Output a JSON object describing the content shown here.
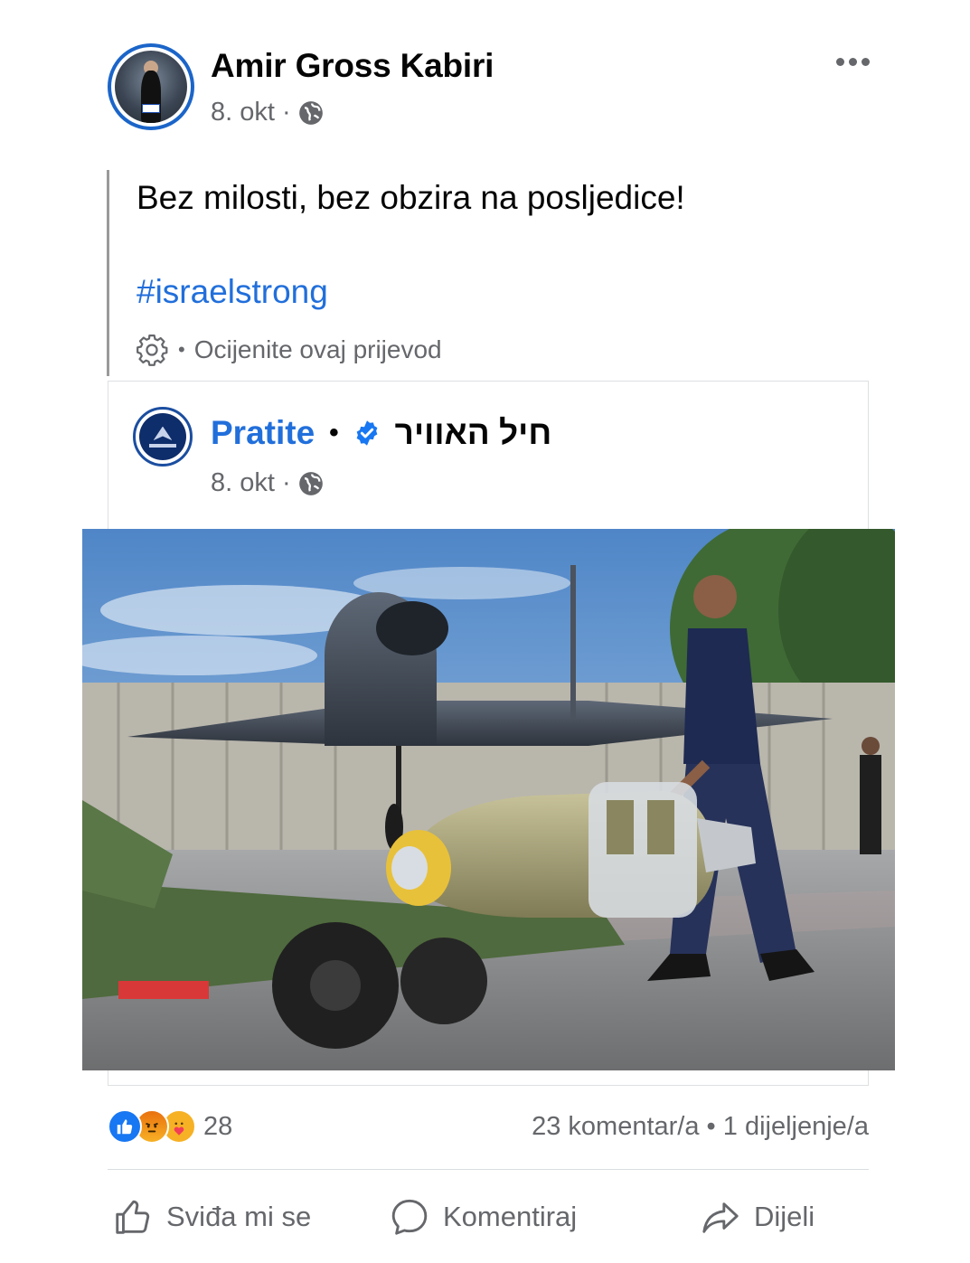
{
  "post": {
    "author": "Amir Gross Kabiri",
    "date": "8. okt",
    "date_sep": "·",
    "privacy_icon": "globe-icon",
    "text": "Bez milosti, bez obzira na posljedice!",
    "hashtag": "#israelstrong",
    "translation_link": "Ocijenite ovaj prijevod",
    "translation_sep": "•"
  },
  "shared": {
    "follow_label": "Pratite",
    "separator": "•",
    "page_name": "חיל האוויר",
    "verified_icon": "verified-badge-icon",
    "date": "8. okt",
    "date_sep": "·",
    "photo_icon": "photo-image"
  },
  "engagement": {
    "reaction_icons": [
      "like-reaction-icon",
      "angry-reaction-icon",
      "care-reaction-icon"
    ],
    "reaction_count": "28",
    "stats": "23 komentar/a • 1 dijeljenje/a"
  },
  "actions": {
    "like": "Sviđa mi se",
    "comment": "Komentiraj",
    "share": "Dijeli"
  },
  "colors": {
    "link_blue": "#216fdb",
    "avatar_ring": "#1b65c9",
    "muted_text": "#65676b",
    "like_blue": "#1877f2"
  }
}
